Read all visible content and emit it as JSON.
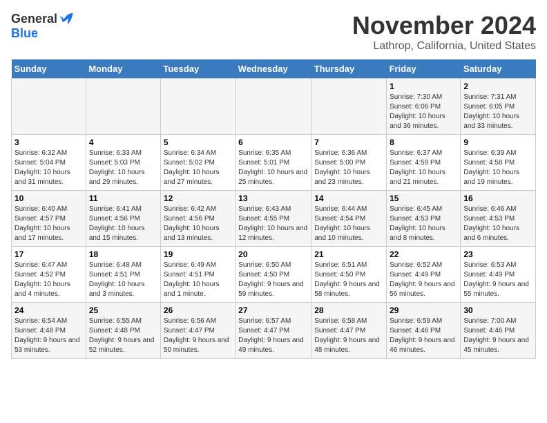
{
  "logo": {
    "general": "General",
    "blue": "Blue"
  },
  "title": "November 2024",
  "subtitle": "Lathrop, California, United States",
  "days_of_week": [
    "Sunday",
    "Monday",
    "Tuesday",
    "Wednesday",
    "Thursday",
    "Friday",
    "Saturday"
  ],
  "weeks": [
    [
      {
        "day": "",
        "info": ""
      },
      {
        "day": "",
        "info": ""
      },
      {
        "day": "",
        "info": ""
      },
      {
        "day": "",
        "info": ""
      },
      {
        "day": "",
        "info": ""
      },
      {
        "day": "1",
        "info": "Sunrise: 7:30 AM\nSunset: 6:06 PM\nDaylight: 10 hours and 36 minutes."
      },
      {
        "day": "2",
        "info": "Sunrise: 7:31 AM\nSunset: 6:05 PM\nDaylight: 10 hours and 33 minutes."
      }
    ],
    [
      {
        "day": "3",
        "info": "Sunrise: 6:32 AM\nSunset: 5:04 PM\nDaylight: 10 hours and 31 minutes."
      },
      {
        "day": "4",
        "info": "Sunrise: 6:33 AM\nSunset: 5:03 PM\nDaylight: 10 hours and 29 minutes."
      },
      {
        "day": "5",
        "info": "Sunrise: 6:34 AM\nSunset: 5:02 PM\nDaylight: 10 hours and 27 minutes."
      },
      {
        "day": "6",
        "info": "Sunrise: 6:35 AM\nSunset: 5:01 PM\nDaylight: 10 hours and 25 minutes."
      },
      {
        "day": "7",
        "info": "Sunrise: 6:36 AM\nSunset: 5:00 PM\nDaylight: 10 hours and 23 minutes."
      },
      {
        "day": "8",
        "info": "Sunrise: 6:37 AM\nSunset: 4:59 PM\nDaylight: 10 hours and 21 minutes."
      },
      {
        "day": "9",
        "info": "Sunrise: 6:39 AM\nSunset: 4:58 PM\nDaylight: 10 hours and 19 minutes."
      }
    ],
    [
      {
        "day": "10",
        "info": "Sunrise: 6:40 AM\nSunset: 4:57 PM\nDaylight: 10 hours and 17 minutes."
      },
      {
        "day": "11",
        "info": "Sunrise: 6:41 AM\nSunset: 4:56 PM\nDaylight: 10 hours and 15 minutes."
      },
      {
        "day": "12",
        "info": "Sunrise: 6:42 AM\nSunset: 4:56 PM\nDaylight: 10 hours and 13 minutes."
      },
      {
        "day": "13",
        "info": "Sunrise: 6:43 AM\nSunset: 4:55 PM\nDaylight: 10 hours and 12 minutes."
      },
      {
        "day": "14",
        "info": "Sunrise: 6:44 AM\nSunset: 4:54 PM\nDaylight: 10 hours and 10 minutes."
      },
      {
        "day": "15",
        "info": "Sunrise: 6:45 AM\nSunset: 4:53 PM\nDaylight: 10 hours and 8 minutes."
      },
      {
        "day": "16",
        "info": "Sunrise: 6:46 AM\nSunset: 4:53 PM\nDaylight: 10 hours and 6 minutes."
      }
    ],
    [
      {
        "day": "17",
        "info": "Sunrise: 6:47 AM\nSunset: 4:52 PM\nDaylight: 10 hours and 4 minutes."
      },
      {
        "day": "18",
        "info": "Sunrise: 6:48 AM\nSunset: 4:51 PM\nDaylight: 10 hours and 3 minutes."
      },
      {
        "day": "19",
        "info": "Sunrise: 6:49 AM\nSunset: 4:51 PM\nDaylight: 10 hours and 1 minute."
      },
      {
        "day": "20",
        "info": "Sunrise: 6:50 AM\nSunset: 4:50 PM\nDaylight: 9 hours and 59 minutes."
      },
      {
        "day": "21",
        "info": "Sunrise: 6:51 AM\nSunset: 4:50 PM\nDaylight: 9 hours and 58 minutes."
      },
      {
        "day": "22",
        "info": "Sunrise: 6:52 AM\nSunset: 4:49 PM\nDaylight: 9 hours and 56 minutes."
      },
      {
        "day": "23",
        "info": "Sunrise: 6:53 AM\nSunset: 4:49 PM\nDaylight: 9 hours and 55 minutes."
      }
    ],
    [
      {
        "day": "24",
        "info": "Sunrise: 6:54 AM\nSunset: 4:48 PM\nDaylight: 9 hours and 53 minutes."
      },
      {
        "day": "25",
        "info": "Sunrise: 6:55 AM\nSunset: 4:48 PM\nDaylight: 9 hours and 52 minutes."
      },
      {
        "day": "26",
        "info": "Sunrise: 6:56 AM\nSunset: 4:47 PM\nDaylight: 9 hours and 50 minutes."
      },
      {
        "day": "27",
        "info": "Sunrise: 6:57 AM\nSunset: 4:47 PM\nDaylight: 9 hours and 49 minutes."
      },
      {
        "day": "28",
        "info": "Sunrise: 6:58 AM\nSunset: 4:47 PM\nDaylight: 9 hours and 48 minutes."
      },
      {
        "day": "29",
        "info": "Sunrise: 6:59 AM\nSunset: 4:46 PM\nDaylight: 9 hours and 46 minutes."
      },
      {
        "day": "30",
        "info": "Sunrise: 7:00 AM\nSunset: 4:46 PM\nDaylight: 9 hours and 45 minutes."
      }
    ]
  ]
}
